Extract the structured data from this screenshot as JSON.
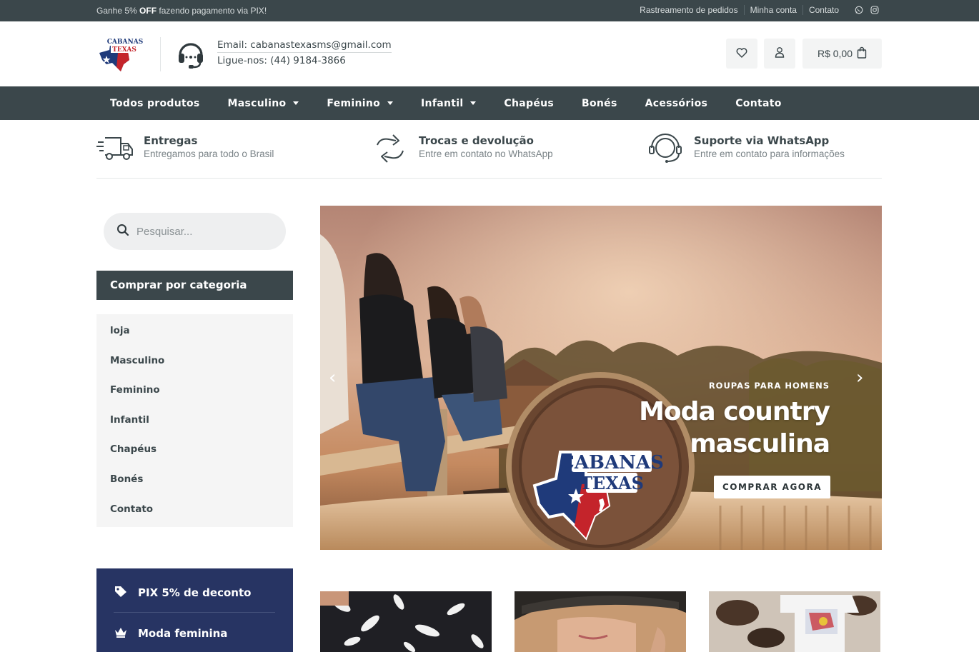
{
  "topbar": {
    "promo_prefix": "Ganhe 5% ",
    "promo_bold": "OFF",
    "promo_suffix": " fazendo pagamento via PIX!",
    "links": [
      "Rastreamento de pedidos",
      "Minha conta",
      "Contato"
    ],
    "social_icons": [
      "whatsapp-icon",
      "instagram-icon"
    ]
  },
  "header": {
    "logo_text_1": "CABANAS",
    "logo_text_2": "TEXAS",
    "email_line": "Email: cabanastexasms@gmail.com",
    "phone_line": "Ligue-nos: (44) 9184-3866",
    "cart_total": "R$ 0,00"
  },
  "nav": {
    "items": [
      {
        "label": "Todos produtos"
      },
      {
        "label": "Masculino"
      },
      {
        "label": "Feminino"
      },
      {
        "label": "Infantil"
      },
      {
        "label": "Chapéus"
      },
      {
        "label": "Bonés"
      },
      {
        "label": "Acessórios"
      },
      {
        "label": "Contato"
      }
    ]
  },
  "features": [
    {
      "title": "Entregas",
      "subtitle": "Entregamos para todo o Brasil",
      "icon": "truck-icon"
    },
    {
      "title": "Trocas e devolução",
      "subtitle": "Entre em contato no WhatsApp",
      "icon": "exchange-icon"
    },
    {
      "title": "Suporte via WhatsApp",
      "subtitle": "Entre em contato para informações",
      "icon": "support-agent-icon"
    }
  ],
  "sidebar": {
    "search_placeholder": "Pesquisar...",
    "category_heading": "Comprar por categoria",
    "categories": [
      "loja",
      "Masculino",
      "Feminino",
      "Infantil",
      "Chapéus",
      "Bonés",
      "Contato"
    ],
    "promo_items": [
      {
        "label": "PIX 5% de deconto",
        "icon": "tag-icon"
      },
      {
        "label": "Moda feminina",
        "icon": "crown-icon"
      }
    ]
  },
  "hero": {
    "eyebrow": "ROUPAS PARA HOMENS",
    "title_line1": "Moda country",
    "title_line2": "masculina",
    "cta": "COMPRAR AGORA",
    "badge_text_1": "CABANAS",
    "badge_text_2": "TEXAS"
  },
  "colors": {
    "dark_slate": "#3b474b",
    "navy_promo": "#273463",
    "light_panel": "#f5f5f5",
    "texas_blue": "#1f3a7a",
    "texas_red": "#c4242b"
  }
}
